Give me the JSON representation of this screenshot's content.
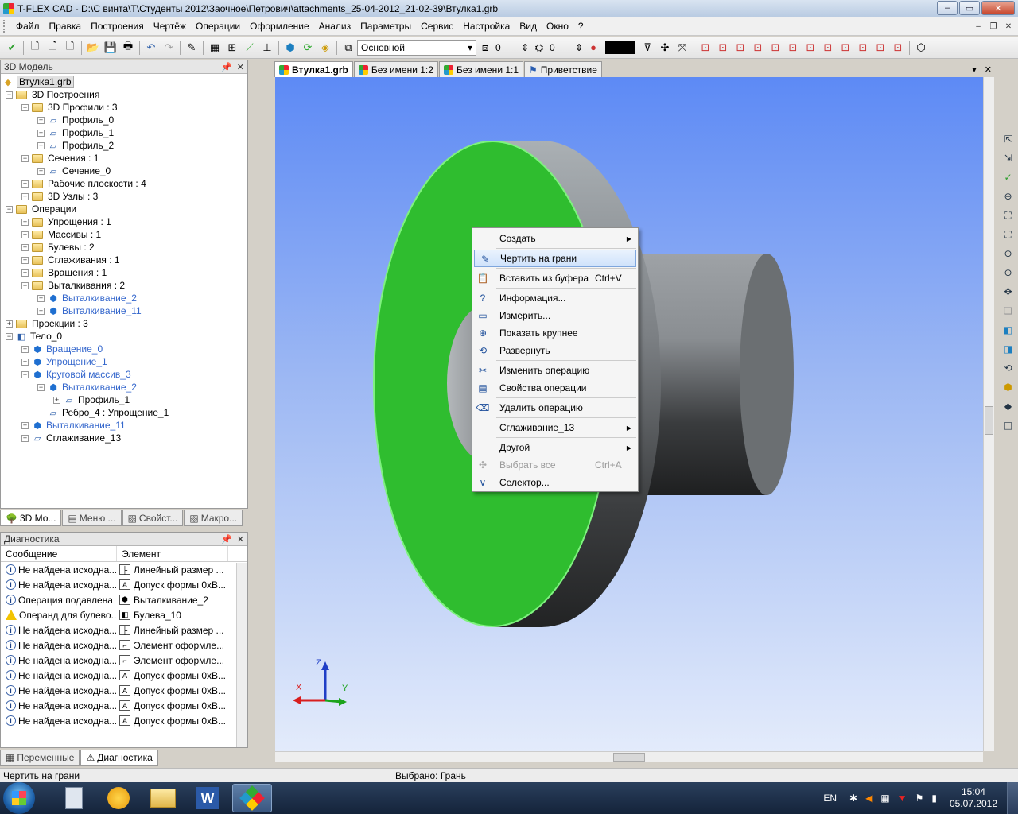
{
  "window": {
    "title": "T-FLEX CAD - D:\\С винта\\Т\\Студенты 2012\\Заочное\\Петрович\\attachments_25-04-2012_21-02-39\\Втулка1.grb",
    "minimize": "–",
    "maximize": "▭",
    "close": "✕"
  },
  "menu": {
    "items": [
      "Файл",
      "Правка",
      "Построения",
      "Чертёж",
      "Операции",
      "Оформление",
      "Анализ",
      "Параметры",
      "Сервис",
      "Настройка",
      "Вид",
      "Окно",
      "?"
    ]
  },
  "toolbar": {
    "layer": "Основной",
    "value1": "0",
    "value2": "0",
    "color": "#000000"
  },
  "model_panel": {
    "title": "3D Модель",
    "tree": [
      {
        "label": "Втулка1.grb",
        "level": 0,
        "kind": "root"
      },
      {
        "label": "3D Построения",
        "level": 1,
        "kind": "folder",
        "exp": "−"
      },
      {
        "label": "3D Профили : 3",
        "level": 2,
        "kind": "folder",
        "exp": "−"
      },
      {
        "label": "Профиль_0",
        "level": 3,
        "kind": "item",
        "exp": "+"
      },
      {
        "label": "Профиль_1",
        "level": 3,
        "kind": "item",
        "exp": "+"
      },
      {
        "label": "Профиль_2",
        "level": 3,
        "kind": "item",
        "exp": "+"
      },
      {
        "label": "Сечения : 1",
        "level": 2,
        "kind": "folder",
        "exp": "−"
      },
      {
        "label": "Сечение_0",
        "level": 3,
        "kind": "item",
        "exp": "+"
      },
      {
        "label": "Рабочие плоскости : 4",
        "level": 2,
        "kind": "folder",
        "exp": "+"
      },
      {
        "label": "3D Узлы : 3",
        "level": 2,
        "kind": "folder",
        "exp": "+"
      },
      {
        "label": "Операции",
        "level": 1,
        "kind": "folder",
        "exp": "−"
      },
      {
        "label": "Упрощения : 1",
        "level": 2,
        "kind": "folder",
        "exp": "+"
      },
      {
        "label": "Массивы : 1",
        "level": 2,
        "kind": "folder",
        "exp": "+"
      },
      {
        "label": "Булевы : 2",
        "level": 2,
        "kind": "folder",
        "exp": "+"
      },
      {
        "label": "Сглаживания : 1",
        "level": 2,
        "kind": "folder",
        "exp": "+"
      },
      {
        "label": "Вращения : 1",
        "level": 2,
        "kind": "folder",
        "exp": "+"
      },
      {
        "label": "Выталкивания : 2",
        "level": 2,
        "kind": "folder",
        "exp": "−"
      },
      {
        "label": "Выталкивание_2",
        "level": 3,
        "kind": "blue",
        "exp": "+"
      },
      {
        "label": "Выталкивание_11",
        "level": 3,
        "kind": "blue",
        "exp": "+"
      },
      {
        "label": "Проекции : 3",
        "level": 1,
        "kind": "folder",
        "exp": "+"
      },
      {
        "label": "Тело_0",
        "level": 1,
        "kind": "body",
        "exp": "−"
      },
      {
        "label": "Вращение_0",
        "level": 2,
        "kind": "blue",
        "exp": "+"
      },
      {
        "label": "Упрощение_1",
        "level": 2,
        "kind": "blue",
        "exp": "+"
      },
      {
        "label": "Круговой массив_3",
        "level": 2,
        "kind": "blue",
        "exp": "−"
      },
      {
        "label": "Выталкивание_2",
        "level": 3,
        "kind": "blue",
        "exp": "−"
      },
      {
        "label": "Профиль_1",
        "level": 4,
        "kind": "item",
        "exp": "+"
      },
      {
        "label": "Ребро_4 : Упрощение_1",
        "level": 3,
        "kind": "item",
        "exp": ""
      },
      {
        "label": "Выталкивание_11",
        "level": 2,
        "kind": "blue",
        "exp": "+"
      },
      {
        "label": "Сглаживание_13",
        "level": 2,
        "kind": "item",
        "exp": "+"
      }
    ],
    "tabs": [
      "3D Мо...",
      "Меню ...",
      "Свойст...",
      "Макро..."
    ]
  },
  "diagnostics": {
    "title": "Диагностика",
    "columns": [
      "Сообщение",
      "Элемент"
    ],
    "rows": [
      {
        "type": "info",
        "message": "Не найдена исходна...",
        "element": "Линейный размер ...",
        "icon": "dim"
      },
      {
        "type": "info",
        "message": "Не найдена исходна...",
        "element": "Допуск формы 0xB...",
        "icon": "A"
      },
      {
        "type": "info",
        "message": "Операция подавлена",
        "element": "Выталкивание_2",
        "icon": "op"
      },
      {
        "type": "warn",
        "message": "Операнд для булево...",
        "element": "Булева_10",
        "icon": "bool"
      },
      {
        "type": "info",
        "message": "Не найдена исходна...",
        "element": "Линейный размер ...",
        "icon": "dim"
      },
      {
        "type": "info",
        "message": "Не найдена исходна...",
        "element": "Элемент оформле...",
        "icon": "leader"
      },
      {
        "type": "info",
        "message": "Не найдена исходна...",
        "element": "Элемент оформле...",
        "icon": "leader"
      },
      {
        "type": "info",
        "message": "Не найдена исходна...",
        "element": "Допуск формы 0xB...",
        "icon": "A"
      },
      {
        "type": "info",
        "message": "Не найдена исходна...",
        "element": "Допуск формы 0xB...",
        "icon": "A"
      },
      {
        "type": "info",
        "message": "Не найдена исходна...",
        "element": "Допуск формы 0xB...",
        "icon": "A"
      },
      {
        "type": "info",
        "message": "Не найдена исходна...",
        "element": "Допуск формы 0xB...",
        "icon": "A"
      }
    ],
    "tabs": [
      "Переменные",
      "Диагностика"
    ]
  },
  "doc_tabs": [
    "Втулка1.grb",
    "Без имени 1:2",
    "Без имени 1:1",
    "Приветствие"
  ],
  "context_menu": {
    "items": [
      {
        "label": "Создать",
        "submenu": true,
        "icon": ""
      },
      {
        "sep": true
      },
      {
        "label": "Чертить на грани",
        "highlight": true,
        "icon": "pencil-icon"
      },
      {
        "sep": true
      },
      {
        "label": "Вставить из буфера",
        "shortcut": "Ctrl+V",
        "icon": "paste-icon"
      },
      {
        "sep": true
      },
      {
        "label": "Информация...",
        "icon": "question-icon"
      },
      {
        "label": "Измерить...",
        "icon": "measure-icon"
      },
      {
        "label": "Показать крупнее",
        "icon": "zoom-icon"
      },
      {
        "label": "Развернуть",
        "icon": "rotate-icon"
      },
      {
        "sep": true
      },
      {
        "label": "Изменить операцию",
        "icon": "scissors-icon"
      },
      {
        "label": "Свойства операции",
        "icon": "properties-icon"
      },
      {
        "sep": true
      },
      {
        "label": "Удалить операцию",
        "icon": "delete-icon"
      },
      {
        "sep": true
      },
      {
        "label": "Сглаживание_13",
        "submenu": true,
        "icon": ""
      },
      {
        "sep": true
      },
      {
        "label": "Другой",
        "submenu": true,
        "icon": ""
      },
      {
        "label": "Выбрать все",
        "shortcut": "Ctrl+A",
        "disabled": true,
        "icon": "select-all-icon"
      },
      {
        "label": "Селектор...",
        "icon": "filter-icon"
      }
    ]
  },
  "axes": {
    "z": "Z",
    "x": "X",
    "y": "Y"
  },
  "status": {
    "left": "Чертить на грани",
    "center": "Выбрано: Грань"
  },
  "taskbar": {
    "lang": "EN",
    "time": "15:04",
    "date": "05.07.2012"
  },
  "colors": {
    "face_highlight": "#2fbd2f",
    "viewport_top": "#5d8af5",
    "viewport_bottom": "#e3ebfb"
  }
}
